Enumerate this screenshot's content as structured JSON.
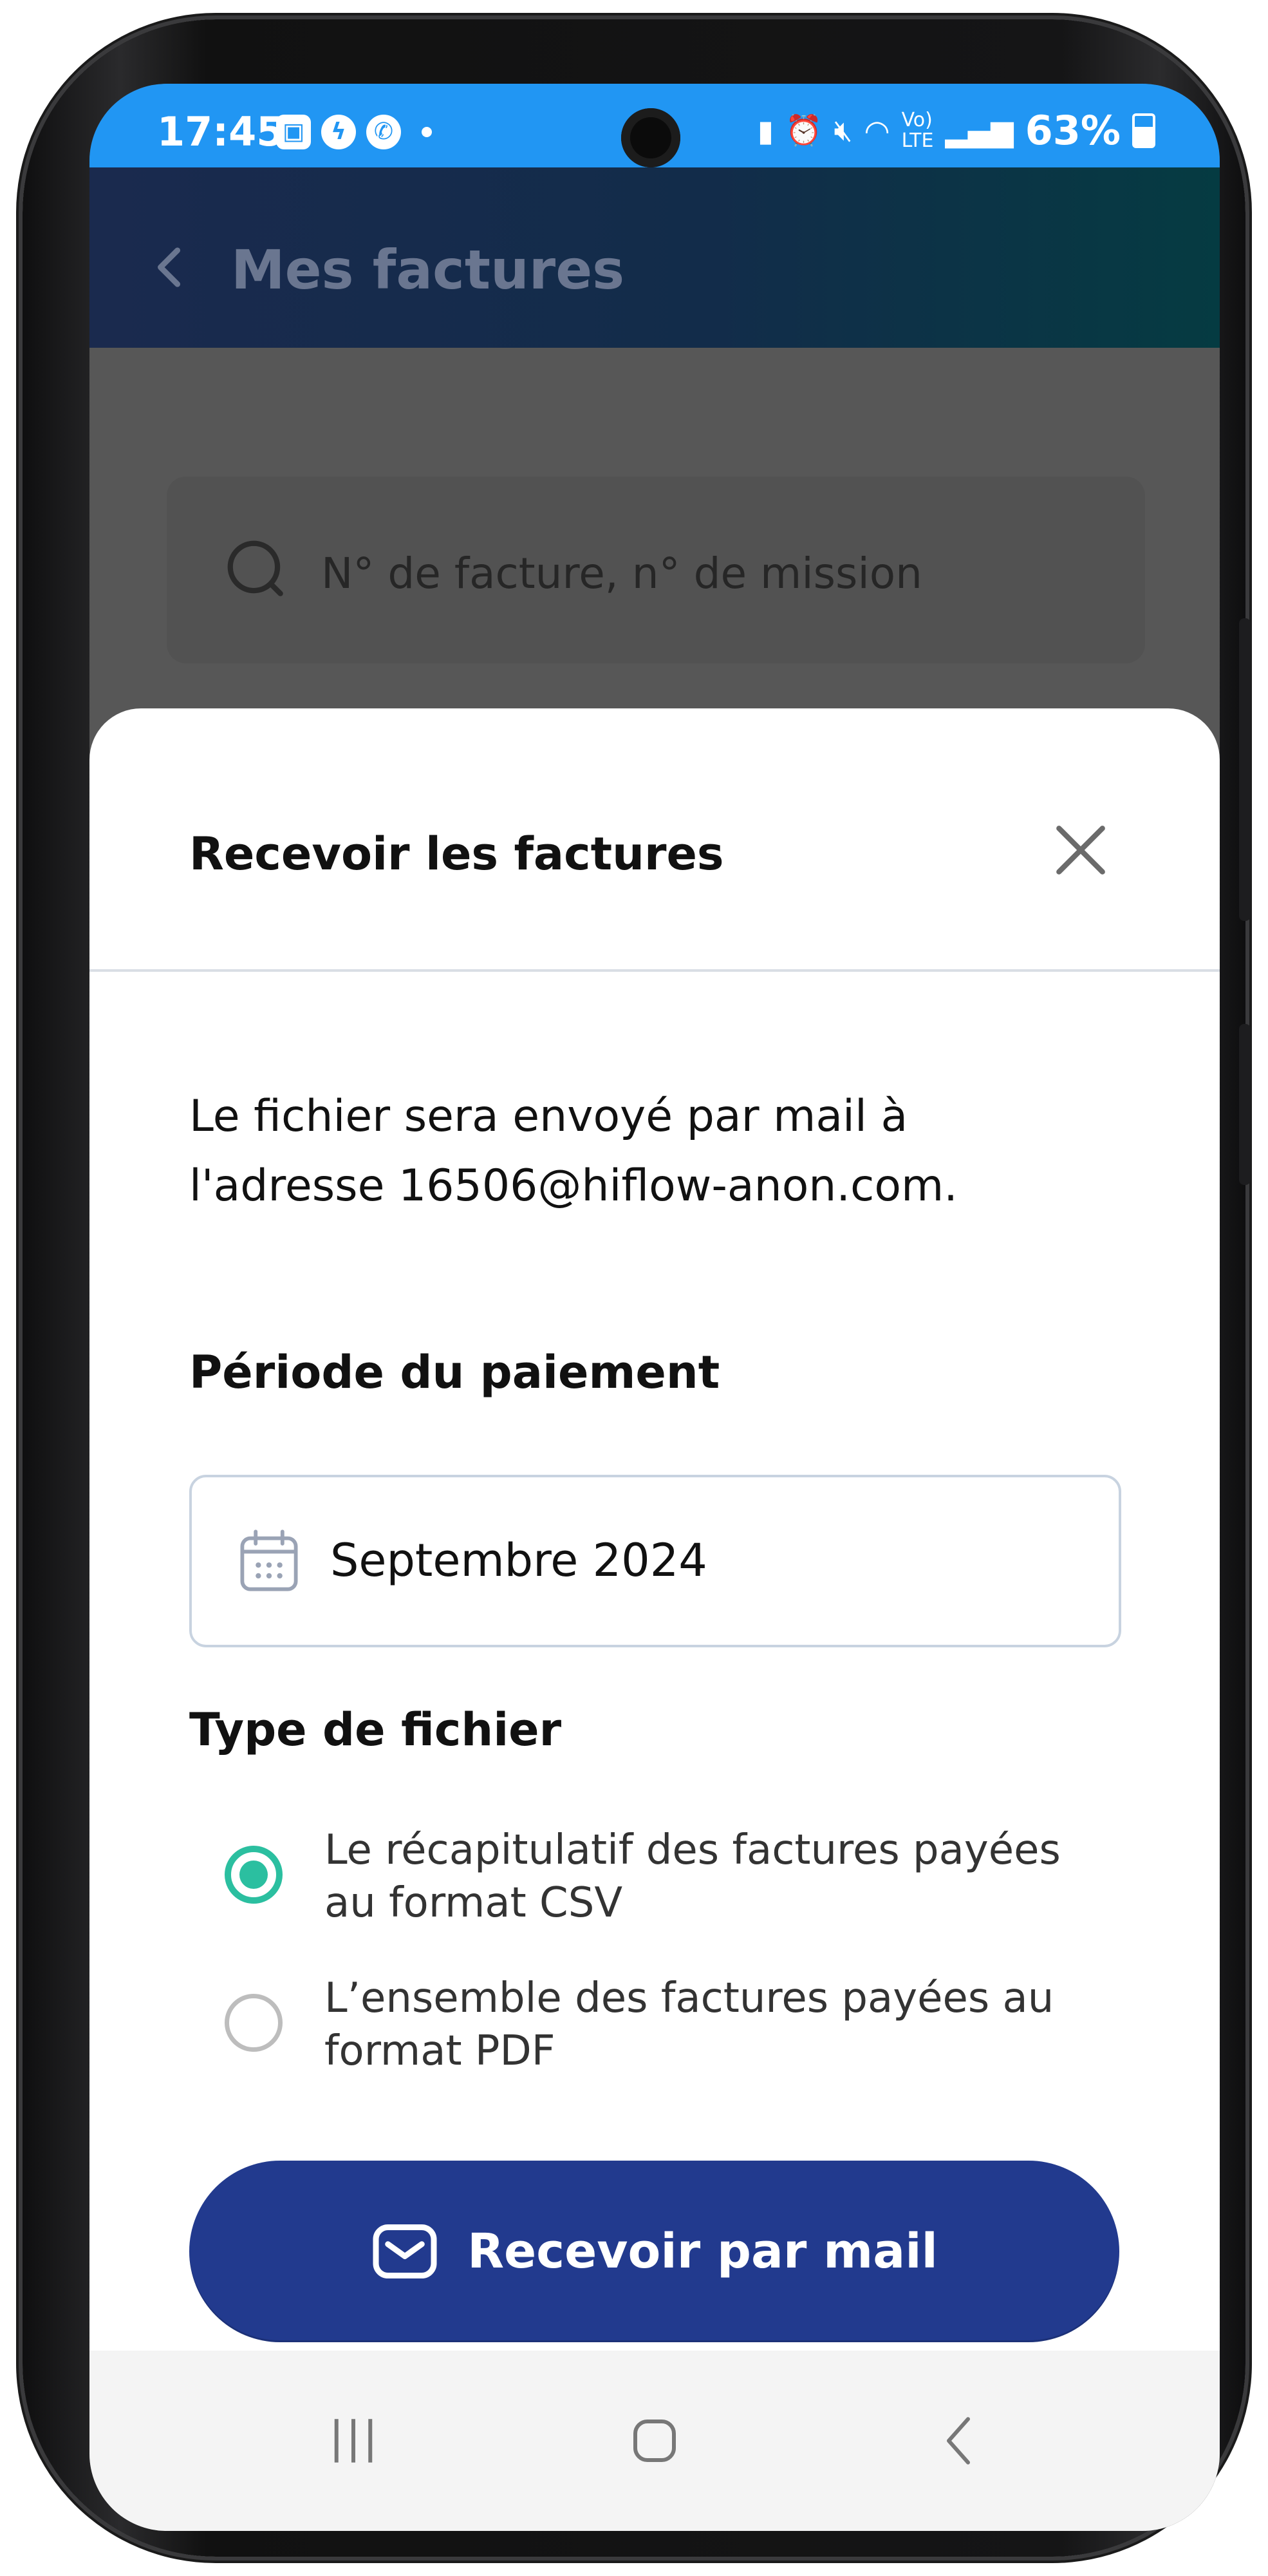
{
  "status_bar": {
    "time": "17:45",
    "battery": "63%",
    "notification_icons": [
      "gallery-icon",
      "messenger-icon",
      "whatsapp-icon"
    ],
    "system_icons": [
      "battery-saver-icon",
      "alarm-icon",
      "mute-icon",
      "wifi-icon",
      "volte-icon",
      "signal-icon",
      "battery-icon"
    ],
    "colors": {
      "background": "#2196f3",
      "text": "#ffffff"
    }
  },
  "header": {
    "title": "Mes factures"
  },
  "search": {
    "placeholder": "N° de facture, n° de mission"
  },
  "sheet": {
    "title": "Recevoir les factures",
    "info_line1": "Le fichier sera envoyé par mail à",
    "info_line2": "l'adresse 16506@hiflow-anon.com.",
    "period_label": "Période du paiement",
    "period_value": "Septembre 2024",
    "file_type_label": "Type de fichier",
    "options": [
      {
        "line1": "Le récapitulatif des factures payées",
        "line2": "au format CSV",
        "selected": true
      },
      {
        "line1": "L’ensemble des factures payées au",
        "line2": "format PDF",
        "selected": false
      }
    ],
    "submit_label": "Recevoir par mail"
  },
  "colors": {
    "accent": "#2bbfa0",
    "primary_button": "#223a8e"
  }
}
